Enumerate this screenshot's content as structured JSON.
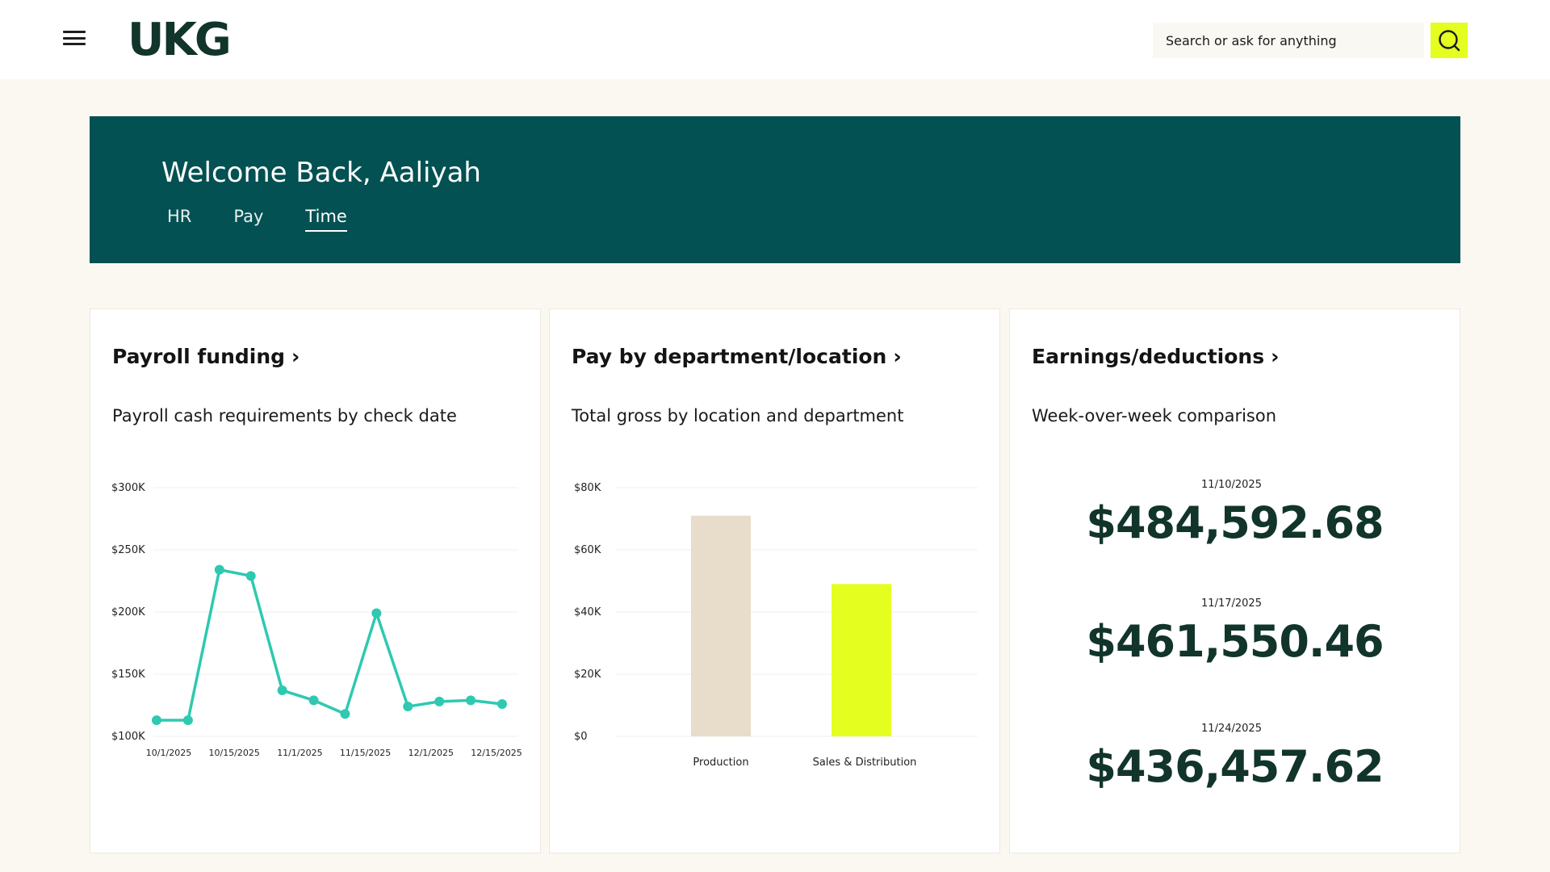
{
  "header": {
    "logo_text": "UKG",
    "search_placeholder": "Search or ask for anything",
    "icons": {
      "menu": "menu-icon",
      "search": "search-icon"
    }
  },
  "banner": {
    "welcome": "Welcome Back, Aaliyah",
    "tabs": [
      {
        "label": "HR",
        "active": false
      },
      {
        "label": "Pay",
        "active": false
      },
      {
        "label": "Time",
        "active": true
      }
    ]
  },
  "cards": {
    "payroll": {
      "title": "Payroll funding",
      "subtitle": "Payroll cash requirements by check date"
    },
    "department": {
      "title": "Pay by department/location",
      "subtitle": "Total gross by location and department"
    },
    "earnings": {
      "title": "Earnings/deductions",
      "subtitle": "Week-over-week comparison",
      "items": [
        {
          "date": "11/10/2025",
          "value": "$484,592.68"
        },
        {
          "date": "11/17/2025",
          "value": "$461,550.46"
        },
        {
          "date": "11/24/2025",
          "value": "$436,457.62"
        }
      ]
    }
  },
  "colors": {
    "brand_dark": "#035152",
    "accent_yellow": "#e4ff1f",
    "line_teal": "#2ec9b0",
    "bar_beige": "#e8dccb",
    "bar_yellow": "#e4ff1f",
    "kpi_text": "#11342b"
  },
  "chart_data": [
    {
      "type": "line",
      "x_tick_labels": [
        "10/1/2025",
        "10/15/2025",
        "11/1/2025",
        "11/15/2025",
        "12/1/2025",
        "12/15/2025"
      ],
      "y_tick_labels": [
        "$300K",
        "$250K",
        "$200K",
        "$150K",
        "$100K"
      ],
      "ylim": [
        100000,
        300000
      ],
      "grid": true,
      "series": [
        {
          "values": [
            113000,
            113000,
            234000,
            229000,
            137000,
            129000,
            118000,
            199000,
            124000,
            128000,
            129000,
            126000
          ]
        }
      ]
    },
    {
      "type": "bar",
      "categories": [
        "Production",
        "Sales & Distribution"
      ],
      "values": [
        71000,
        49000
      ],
      "y_tick_labels": [
        "$80K",
        "$60K",
        "$40K",
        "$20K",
        "$0"
      ],
      "ylim": [
        0,
        80000
      ],
      "grid": true,
      "colors": [
        "#e8dccb",
        "#e4ff1f"
      ]
    }
  ]
}
